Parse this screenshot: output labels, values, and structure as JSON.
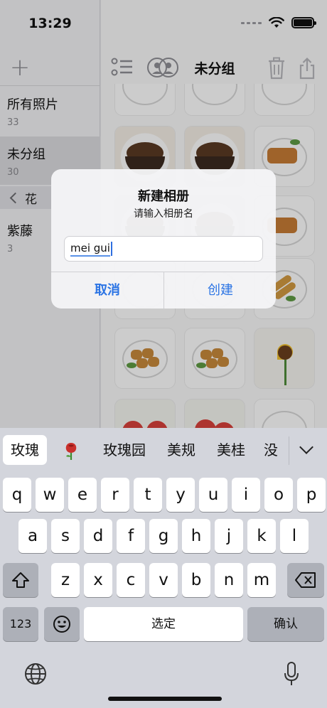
{
  "status": {
    "time": "13:29"
  },
  "sidebar": {
    "add_label": "+",
    "albums": [
      {
        "name": "所有照片",
        "count": "33"
      },
      {
        "name": "未分组",
        "count": "30"
      },
      {
        "name": "紫藤",
        "count": "3"
      }
    ],
    "group": {
      "label": "花"
    }
  },
  "toolbar": {
    "title": "未分组"
  },
  "dialog": {
    "title": "新建相册",
    "message": "请输入相册名",
    "input_value": "mei gui",
    "cancel_label": "取消",
    "create_label": "创建"
  },
  "keyboard": {
    "candidates": [
      "玫瑰",
      "🌹",
      "玫瑰园",
      "美规",
      "美桂",
      "没"
    ],
    "rows": [
      [
        "q",
        "w",
        "e",
        "r",
        "t",
        "y",
        "u",
        "i",
        "o",
        "p"
      ],
      [
        "a",
        "s",
        "d",
        "f",
        "g",
        "h",
        "j",
        "k",
        "l"
      ],
      [
        "z",
        "x",
        "c",
        "v",
        "b",
        "n",
        "m"
      ]
    ],
    "mode_label": "123",
    "space_label": "选定",
    "return_label": "确认"
  },
  "colors": {
    "accent": "#2b74e4",
    "keyboard_bg": "#d3d5dc",
    "dark_key": "#adb0b8"
  }
}
